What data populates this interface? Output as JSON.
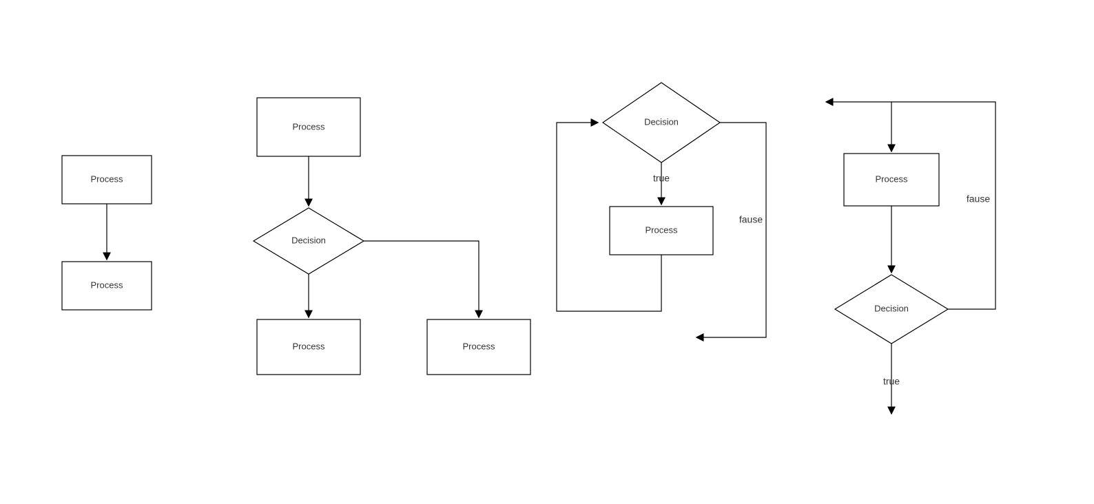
{
  "diagrams": {
    "seq": {
      "process_top": "Process",
      "process_bottom": "Process"
    },
    "branch": {
      "process_top": "Process",
      "decision": "Decision",
      "process_left": "Process",
      "process_right": "Process"
    },
    "while_loop": {
      "decision": "Decision",
      "process": "Process",
      "true_label": "true",
      "false_label": "fause"
    },
    "do_while": {
      "process": "Process",
      "decision": "Decision",
      "true_label": "true",
      "false_label": "fause"
    }
  }
}
